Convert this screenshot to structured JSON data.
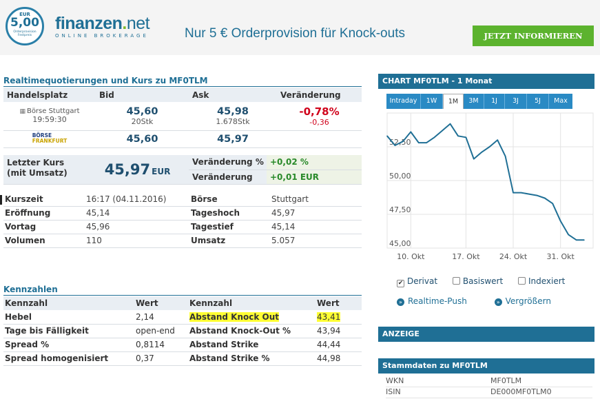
{
  "banner": {
    "badge_currency": "EUR",
    "badge_value": "5,00",
    "badge_sub": "Orderprovision Festpreis",
    "logo_name_a": "finanzen",
    "logo_dot": ".",
    "logo_name_b": "net",
    "logo_tag": "ONLINE BROKERAGE",
    "promo": "Nur 5 € Orderprovision für Knock-outs",
    "cta": "JETZT INFORMIEREN"
  },
  "quotes": {
    "title": "Realtimequotierungen und Kurs zu MF0TLM",
    "headers": [
      "Handelsplatz",
      "Bid",
      "Ask",
      "Veränderung"
    ],
    "rows": [
      {
        "place": "Börse Stuttgart",
        "time": "19:59:30",
        "bid": "45,60",
        "bid_qty": "20Stk",
        "ask": "45,98",
        "ask_qty": "1.678Stk",
        "change_pct": "-0,78%",
        "change_abs": "-0,36"
      },
      {
        "place_logo_a": "BÖRSE",
        "place_logo_b": "FRANKFURT",
        "bid": "45,60",
        "ask": "45,97"
      }
    ]
  },
  "last": {
    "label": "Letzter Kurs (mit Umsatz)",
    "price": "45,97",
    "unit": "EUR",
    "chg_pct_label": "Veränderung %",
    "chg_pct": "+0,02 %",
    "chg_label": "Veränderung",
    "chg": "+0,01 EUR"
  },
  "details": [
    {
      "k1": "Kurszeit",
      "v1": "16:17 (04.11.2016)",
      "k2": "Börse",
      "v2": "Stuttgart"
    },
    {
      "k1": "Eröffnung",
      "v1": "45,14",
      "k2": "Tageshoch",
      "v2": "45,97"
    },
    {
      "k1": "Vortag",
      "v1": "45,96",
      "k2": "Tagestief",
      "v2": "45,14"
    },
    {
      "k1": "Volumen",
      "v1": "110",
      "k2": "Umsatz",
      "v2": "5.057"
    }
  ],
  "kennzahlen": {
    "title": "Kennzahlen",
    "headers": [
      "Kennzahl",
      "Wert",
      "Kennzahl",
      "Wert"
    ],
    "rows": [
      {
        "k1": "Hebel",
        "v1": "2,14",
        "k2": "Abstand Knock Out",
        "v2": "43,41"
      },
      {
        "k1": "Tage bis Fälligkeit",
        "v1": "open-end",
        "k2": "Abstand Knock-Out %",
        "v2": "43,94"
      },
      {
        "k1": "Spread %",
        "v1": "0,8114",
        "k2": "Abstand Strike",
        "v2": "44,44"
      },
      {
        "k1": "Spread homogenisiert",
        "v1": "0,37",
        "k2": "Abstand Strike %",
        "v2": "44,98"
      }
    ]
  },
  "chart_panel": {
    "title": "CHART MF0TLM - 1 Monat",
    "tabs": [
      "Intraday",
      "1W",
      "1M",
      "3M",
      "1J",
      "3J",
      "5J",
      "Max"
    ],
    "active_tab": "1M",
    "checkboxes": [
      {
        "label": "Derivat",
        "checked": true
      },
      {
        "label": "Basiswert",
        "checked": false
      },
      {
        "label": "Indexiert",
        "checked": false
      }
    ],
    "links": [
      "Realtime-Push",
      "Vergrößern"
    ]
  },
  "chart_data": {
    "type": "line",
    "title": "",
    "xlabel": "",
    "ylabel": "",
    "x_ticks": [
      "10. Okt",
      "17. Okt",
      "24. Okt",
      "31. Okt"
    ],
    "y_ticks": [
      "45,00",
      "47,50",
      "50,00",
      "52,50"
    ],
    "ylim": [
      45,
      55
    ],
    "grid": true,
    "series": [
      {
        "x": [
          0,
          1,
          2,
          3,
          4,
          5,
          6,
          7,
          8,
          9,
          10,
          11,
          12,
          13,
          14,
          15,
          16,
          17,
          18,
          19,
          20,
          21,
          22,
          23,
          24,
          25
        ],
        "values": [
          53.3,
          52.6,
          52.9,
          53.6,
          52.8,
          52.8,
          53.2,
          53.7,
          54.2,
          53.3,
          53.2,
          51.6,
          52.1,
          52.5,
          53.0,
          51.8,
          49.1,
          49.1,
          49.0,
          48.9,
          48.7,
          48.3,
          47.0,
          46.0,
          45.6,
          45.6
        ],
        "color": "#1f6f95"
      }
    ]
  },
  "anzeige": "ANZEIGE",
  "stamm": {
    "title": "Stammdaten zu MF0TLM",
    "rows": [
      {
        "k": "WKN",
        "v": "MF0TLM"
      },
      {
        "k": "ISIN",
        "v": "DE000MF0TLM0"
      }
    ]
  }
}
